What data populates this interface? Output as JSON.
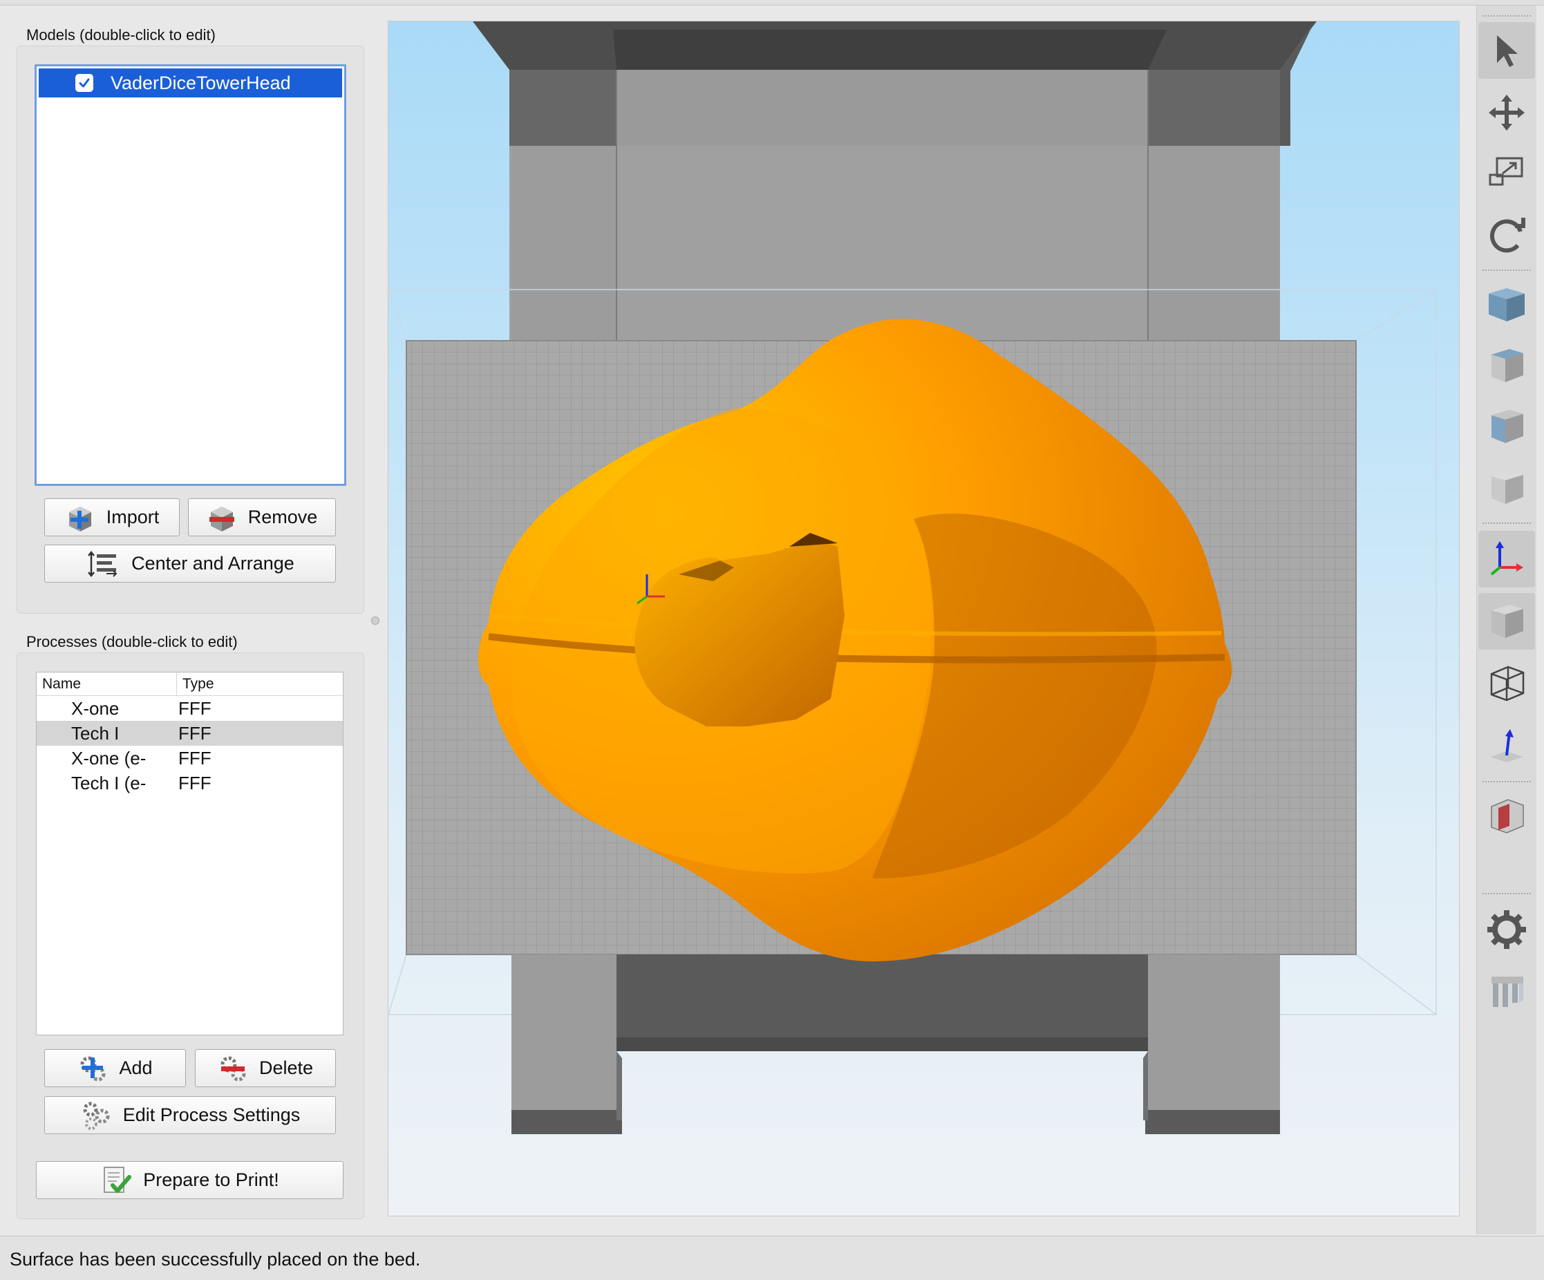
{
  "models": {
    "label": "Models (double-click to edit)",
    "items": [
      {
        "name": "VaderDiceTowerHead",
        "checked": true
      }
    ],
    "buttons": {
      "import": "Import",
      "remove": "Remove",
      "center_arrange": "Center and Arrange"
    }
  },
  "processes": {
    "label": "Processes (double-click to edit)",
    "columns": [
      "Name",
      "Type"
    ],
    "rows": [
      {
        "name": "X-one",
        "type": "FFF"
      },
      {
        "name": "Tech I",
        "type": "FFF",
        "selected": true
      },
      {
        "name": "X-one (e-…",
        "type": "FFF"
      },
      {
        "name": "Tech I (e-…",
        "type": "FFF"
      }
    ],
    "buttons": {
      "add": "Add",
      "delete": "Delete",
      "edit": "Edit Process Settings"
    }
  },
  "prepare_button": "Prepare to Print!",
  "status": "Surface has been successfully placed on the bed.",
  "toolbar": {
    "tools": [
      "select-arrow-icon",
      "move-icon",
      "scale-icon",
      "rotate-icon",
      "view-iso-cube-icon",
      "view-front-cube-icon",
      "view-top-cube-icon",
      "view-side-cube-icon",
      "axes-icon",
      "solid-view-icon",
      "wireframe-view-icon",
      "normals-icon",
      "section-cube-icon",
      "settings-gear-icon",
      "supports-icon"
    ],
    "active": [
      "select-arrow-icon",
      "solid-view-icon"
    ]
  },
  "colors": {
    "selection": "#1a5fd8",
    "model": "#ff9900",
    "sky": "#a9daf7"
  }
}
